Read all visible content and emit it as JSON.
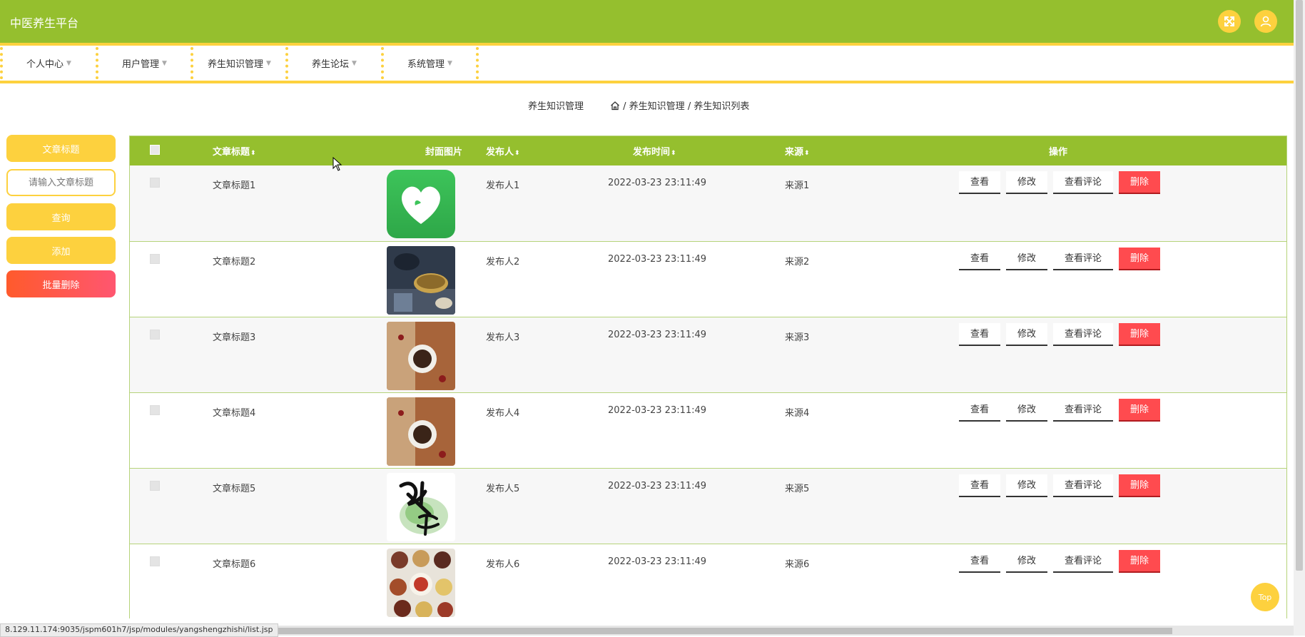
{
  "app": {
    "title": "中医养生平台"
  },
  "header": {
    "fullscreen_icon": "expand-arrows-icon",
    "user_icon": "user-icon"
  },
  "nav": {
    "items": [
      {
        "label": "个人中心"
      },
      {
        "label": "用户管理"
      },
      {
        "label": "养生知识管理"
      },
      {
        "label": "养生论坛"
      },
      {
        "label": "系统管理"
      }
    ]
  },
  "breadcrumb": {
    "page_title": "养生知识管理",
    "path": [
      "养生知识管理",
      "养生知识列表"
    ],
    "separator": "/"
  },
  "sidebar": {
    "filter_label": "文章标题",
    "search_placeholder": "请输入文章标题",
    "query_label": "查询",
    "add_label": "添加",
    "batch_delete_label": "批量删除"
  },
  "table": {
    "headers": [
      "文章标题",
      "封面图片",
      "发布人",
      "发布时间",
      "来源",
      "操作"
    ],
    "sort_symbol": "⬍",
    "rows": [
      {
        "title": "文章标题1",
        "cover": "green-heart-logo",
        "publisher": "发布人1",
        "time": "2022-03-23 23:11:49",
        "source": "来源1"
      },
      {
        "title": "文章标题2",
        "cover": "cooking-pots-photo",
        "publisher": "发布人2",
        "time": "2022-03-23 23:11:49",
        "source": "来源2"
      },
      {
        "title": "文章标题3",
        "cover": "herbal-soup-bowl-photo",
        "publisher": "发布人3",
        "time": "2022-03-23 23:11:49",
        "source": "来源3"
      },
      {
        "title": "文章标题4",
        "cover": "herbal-soup-bowl-photo",
        "publisher": "发布人4",
        "time": "2022-03-23 23:11:49",
        "source": "来源4"
      },
      {
        "title": "文章标题5",
        "cover": "calligraphy-jiankang-image",
        "publisher": "发布人5",
        "time": "2022-03-23 23:11:49",
        "source": "来源5"
      },
      {
        "title": "文章标题6",
        "cover": "grains-bowls-photo",
        "publisher": "发布人6",
        "time": "2022-03-23 23:11:49",
        "source": "来源6"
      }
    ],
    "actions": {
      "view": "查看",
      "edit": "修改",
      "comments": "查看评论",
      "delete": "删除"
    }
  },
  "top_button": "Top",
  "status_url": "8.129.11.174:9035/jspm601h7/jsp/modules/yangshengzhishi/list.jsp",
  "colors": {
    "primary": "#95bf2e",
    "accent": "#fdd13e",
    "danger": "#ff4b4f"
  }
}
